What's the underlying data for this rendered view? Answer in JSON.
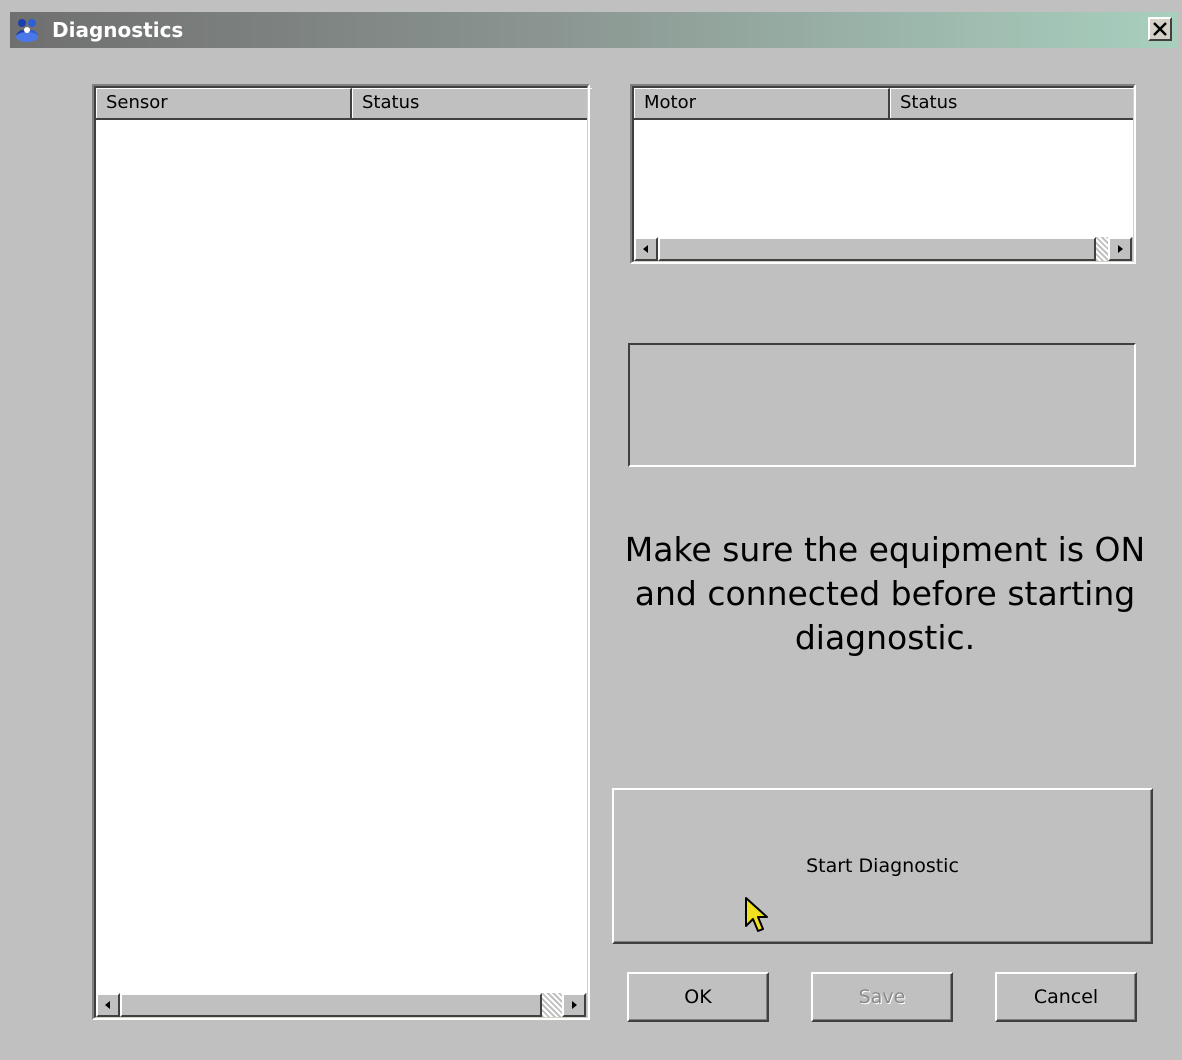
{
  "window": {
    "title": "Diagnostics",
    "close_glyph": "✕"
  },
  "sensor_list": {
    "columns": [
      "Sensor",
      "Status"
    ],
    "rows": []
  },
  "motor_list": {
    "columns": [
      "Motor",
      "Status"
    ],
    "rows": []
  },
  "message": {
    "lines": [
      "Make sure the equipment is ON",
      "and connected before starting",
      "diagnostic."
    ]
  },
  "buttons": {
    "start_diagnostic": "Start Diagnostic",
    "ok": "OK",
    "save": "Save",
    "cancel": "Cancel"
  },
  "icons": {
    "app": "people-icon",
    "close": "close-icon",
    "scroll_left": "arrow-left-icon",
    "scroll_right": "arrow-right-icon",
    "cursor": "mouse-pointer-icon"
  },
  "colors": {
    "title_start": "#6f6f6f",
    "title_end": "#a8cfbe",
    "face": "#c0c0c0",
    "cursor": "#f0e020"
  }
}
